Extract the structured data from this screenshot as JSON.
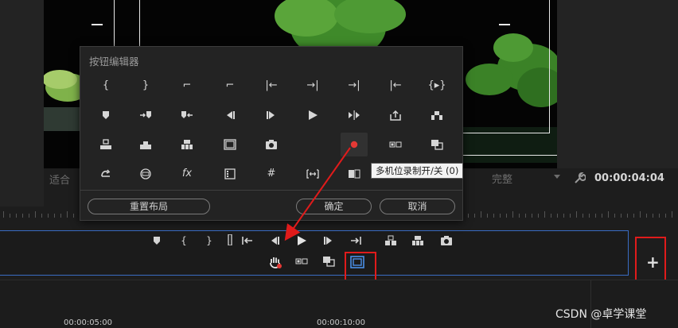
{
  "dialog": {
    "title": "按钮编辑器",
    "grid": [
      [
        "{",
        "}",
        "⌐",
        "⌐",
        "|←",
        "→|",
        "→|",
        "|←",
        "{▸}"
      ],
      [
        "▾",
        "→▾",
        "▾←",
        "◂|",
        "|▸",
        "▶",
        "▸|▸",
        "⇪",
        "▤"
      ],
      [
        "▤",
        "▤",
        "▤",
        "▭",
        "camera",
        "",
        "●",
        "▤▭",
        "▣"
      ],
      [
        "↶",
        "⊖",
        "fx",
        "▥",
        "#",
        "[·]",
        "▣",
        "",
        ""
      ]
    ],
    "buttons": {
      "reset": "重置布局",
      "ok": "确定",
      "cancel": "取消"
    }
  },
  "tooltip": "多机位录制开/关 (0)",
  "status": {
    "left_label": "适合",
    "quality": "完整",
    "timecode": "00:00:04:04"
  },
  "toolbar": {
    "row1": [
      "mark-in",
      "mark-out",
      "mark-out-bracket",
      "clip-marker",
      "go-to-in",
      "step-back",
      "play",
      "step-forward",
      "go-to-out",
      "insert",
      "overwrite",
      "export-frame"
    ],
    "row2": [
      "hand",
      "comparison-view",
      "toggle-proxy",
      "multi-camera-record"
    ]
  },
  "add_button_label": "+",
  "bottom": {
    "tc1": "00:00:05:00",
    "tc2": "00:00:10:00",
    "watermark": "CSDN @卓学课堂"
  },
  "colors": {
    "accent": "#3a6cc4",
    "annotation": "#e01b1b",
    "record_dot": "#e53935"
  }
}
